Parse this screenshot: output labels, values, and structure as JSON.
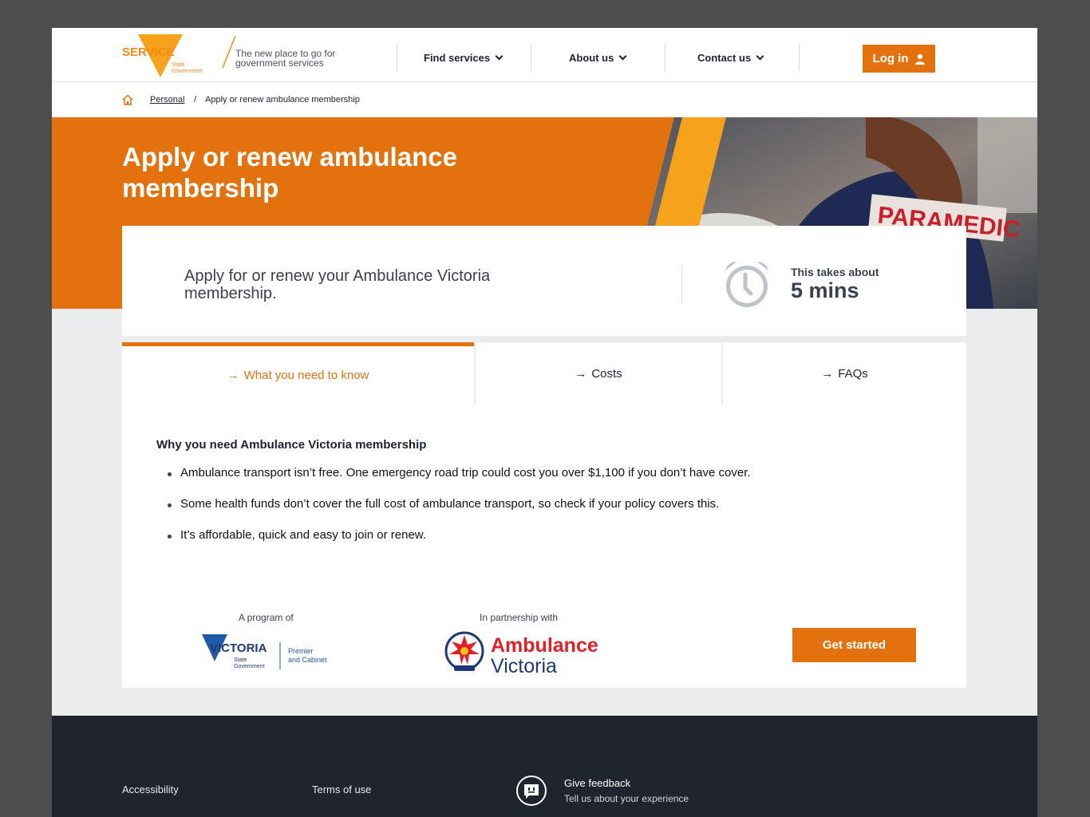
{
  "header": {
    "logo_text": "SERVICE",
    "logo_sub": "State Government",
    "tagline": "The new place to go for government services",
    "nav": [
      {
        "label": "Find services"
      },
      {
        "label": "About us"
      },
      {
        "label": "Contact us"
      }
    ],
    "login_label": "Log in"
  },
  "breadcrumb": {
    "link": "Personal",
    "separator": "/",
    "current": "Apply or renew ambulance membership"
  },
  "hero": {
    "title": "Apply or renew ambulance membership",
    "photo_text": "PARAMEDIC"
  },
  "intro": {
    "text": "Apply for or renew your Ambulance Victoria membership.",
    "takes_label": "This takes about",
    "takes_value": "5 mins"
  },
  "tabs": [
    {
      "label": "What you need to know",
      "active": true
    },
    {
      "label": "Costs",
      "active": false
    },
    {
      "label": "FAQs",
      "active": false
    }
  ],
  "content": {
    "heading": "Why you need Ambulance Victoria membership",
    "bullets": [
      "Ambulance transport isn’t free. One emergency road trip could cost you over $1,100 if you don’t have cover.",
      "Some health funds don’t cover the full cost of ambulance transport, so check if your policy covers this.",
      "It’s affordable, quick and easy to join or renew."
    ],
    "program_label": "A program of",
    "vic_logo_text": "VICTORIA",
    "vic_logo_sub": "State Government",
    "vic_dept": "Premier and Cabinet",
    "partner_label": "In partnership with",
    "amb_line1": "Ambulance",
    "amb_line2": "Victoria",
    "get_started": "Get started"
  },
  "footer": {
    "links": [
      "Accessibility",
      "Terms of use"
    ],
    "feedback_title": "Give feedback",
    "feedback_sub": "Tell us about your experience"
  },
  "colors": {
    "accent": "#e3710e",
    "dark": "#1f242d",
    "text": "#1d2330"
  }
}
